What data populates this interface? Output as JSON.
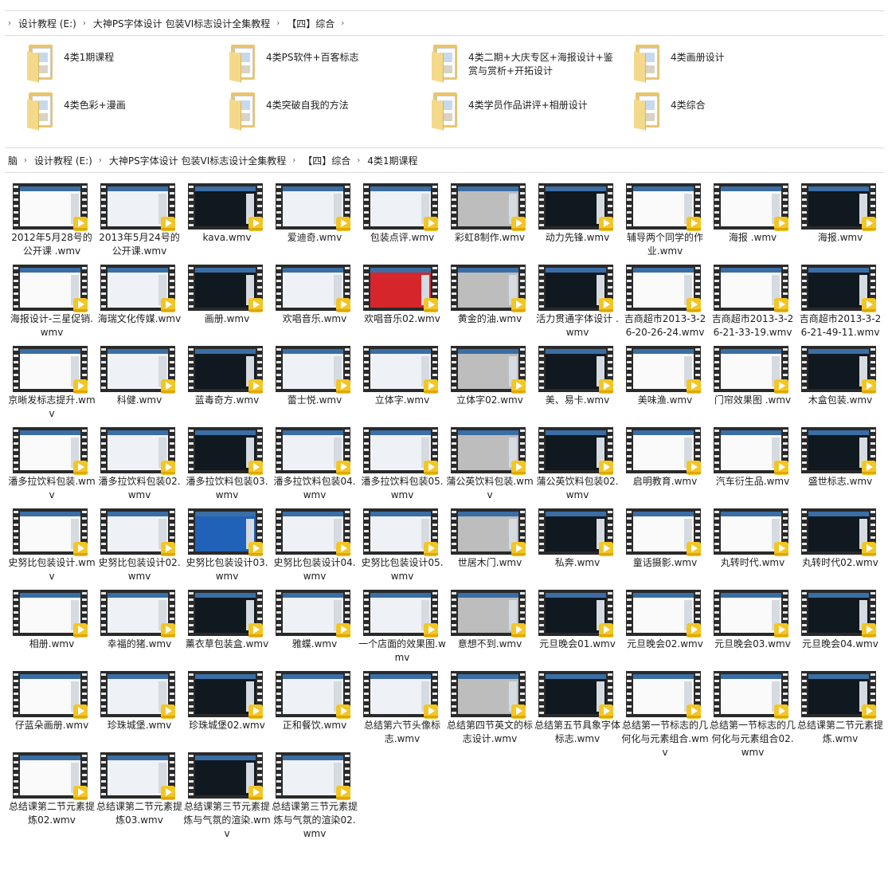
{
  "breadcrumb_top": {
    "items": [
      "设计教程 (E:)",
      "大神PS字体设计 包装VI标志设计全集教程",
      "【四】综合"
    ],
    "chevron_icon": "chevron-right-icon"
  },
  "folders": [
    {
      "label": "4类1期课程"
    },
    {
      "label": "4类PS软件+百客标志"
    },
    {
      "label": "4类二期+大庆专区+海报设计+鉴赏与赏析+开拓设计"
    },
    {
      "label": "4类画册设计"
    },
    {
      "label": "4类色彩+漫画"
    },
    {
      "label": "4类突破自我的方法"
    },
    {
      "label": "4类学员作品讲评+相册设计"
    },
    {
      "label": "4类综合"
    }
  ],
  "breadcrumb_bottom": {
    "items": [
      "脑",
      "设计教程 (E:)",
      "大神PS字体设计 包装VI标志设计全集教程",
      "【四】综合",
      "4类1期课程"
    ],
    "chevron_icon": "chevron-right-icon"
  },
  "files": [
    {
      "name": "2012年5月28号的公开课 .wmv"
    },
    {
      "name": "2013年5月24号的公开课.wmv"
    },
    {
      "name": "kava.wmv"
    },
    {
      "name": "爱迪奇.wmv"
    },
    {
      "name": "包装点评.wmv"
    },
    {
      "name": "彩虹8制作.wmv"
    },
    {
      "name": "动力先锋.wmv"
    },
    {
      "name": "辅导两个同学的作业.wmv"
    },
    {
      "name": "海报 .wmv"
    },
    {
      "name": "海报.wmv"
    },
    {
      "name": "海报设计-三星促销.wmv"
    },
    {
      "name": "海瑞文化传媒.wmv"
    },
    {
      "name": "画册.wmv"
    },
    {
      "name": "欢唱音乐.wmv"
    },
    {
      "name": "欢唱音乐02.wmv"
    },
    {
      "name": "黄金的油.wmv"
    },
    {
      "name": "活力贯通字体设计 .wmv"
    },
    {
      "name": "吉商超市2013-3-26-20-26-24.wmv"
    },
    {
      "name": "吉商超市2013-3-26-21-33-19.wmv"
    },
    {
      "name": "吉商超市2013-3-26-21-49-11.wmv"
    },
    {
      "name": "京晰发标志提升.wmv"
    },
    {
      "name": "科健.wmv"
    },
    {
      "name": "蓝毒奇方.wmv"
    },
    {
      "name": "蕾士悦.wmv"
    },
    {
      "name": "立体字.wmv"
    },
    {
      "name": "立体字02.wmv"
    },
    {
      "name": "美、易卡.wmv"
    },
    {
      "name": "美味渔.wmv"
    },
    {
      "name": "门帘效果图 .wmv"
    },
    {
      "name": "木盒包装.wmv"
    },
    {
      "name": "潘多拉饮料包装.wmv"
    },
    {
      "name": "潘多拉饮料包装02.wmv"
    },
    {
      "name": "潘多拉饮料包装03.wmv"
    },
    {
      "name": "潘多拉饮料包装04.wmv"
    },
    {
      "name": "潘多拉饮料包装05.wmv"
    },
    {
      "name": "蒲公英饮料包装.wmv"
    },
    {
      "name": "蒲公英饮料包装02.wmv"
    },
    {
      "name": "启明教育.wmv"
    },
    {
      "name": "汽车衍生品.wmv"
    },
    {
      "name": "盛世标志.wmv"
    },
    {
      "name": "史努比包装设计.wmv"
    },
    {
      "name": "史努比包装设计02.wmv"
    },
    {
      "name": "史努比包装设计03.wmv"
    },
    {
      "name": "史努比包装设计04.wmv"
    },
    {
      "name": "史努比包装设计05.wmv"
    },
    {
      "name": "世居木门.wmv"
    },
    {
      "name": "私奔.wmv"
    },
    {
      "name": "童话摄影.wmv"
    },
    {
      "name": "丸转时代.wmv"
    },
    {
      "name": "丸转时代02.wmv"
    },
    {
      "name": "相册.wmv"
    },
    {
      "name": "幸福的猪.wmv"
    },
    {
      "name": "薰衣草包装盒.wmv"
    },
    {
      "name": "雅蝶.wmv"
    },
    {
      "name": "一个店面的效果图.wmv"
    },
    {
      "name": "意想不到.wmv"
    },
    {
      "name": "元旦晚会01.wmv"
    },
    {
      "name": "元旦晚会02.wmv"
    },
    {
      "name": "元旦晚会03.wmv"
    },
    {
      "name": "元旦晚会04.wmv"
    },
    {
      "name": "仔蓝朵画册.wmv"
    },
    {
      "name": "珍珠城堡.wmv"
    },
    {
      "name": "珍珠城堡02.wmv"
    },
    {
      "name": "正和餐饮.wmv"
    },
    {
      "name": "总结第六节头像标志.wmv"
    },
    {
      "name": "总结第四节英文的标志设计.wmv"
    },
    {
      "name": "总结第五节具象字体标志.wmv"
    },
    {
      "name": "总结第一节标志的几何化与元素组合.wmv"
    },
    {
      "name": "总结第一节标志的几何化与元素组合02.wmv"
    },
    {
      "name": "总结课第二节元素提炼.wmv"
    },
    {
      "name": "总结课第二节元素提炼02.wmv"
    },
    {
      "name": "总结课第二节元素提炼03.wmv"
    },
    {
      "name": "总结课第三节元素提炼与气氛的渲染.wmv"
    },
    {
      "name": "总结课第三节元素提炼与气氛的渲染02.wmv"
    }
  ],
  "icons": {
    "folder": "folder-icon",
    "video_thumbnail": "video-thumbnail-icon",
    "player_badge": "play-badge-icon"
  },
  "colors": {
    "folder": "#e9c46a",
    "player_badge": "#f3c623",
    "film": "#2a2a2a"
  }
}
